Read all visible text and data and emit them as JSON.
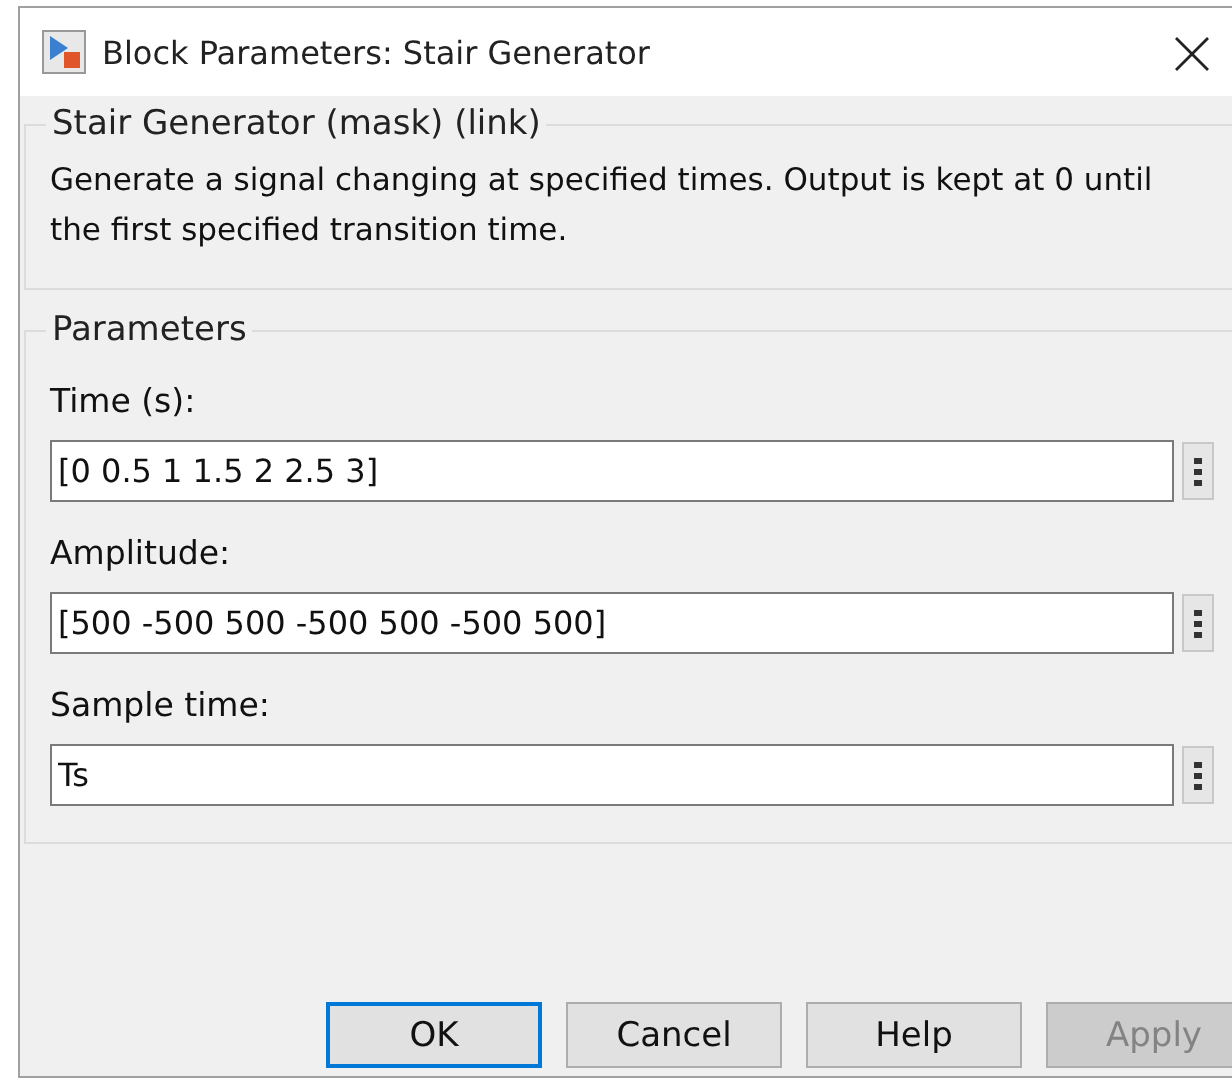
{
  "window": {
    "title": "Block Parameters: Stair Generator"
  },
  "description_group": {
    "title": "Stair Generator (mask) (link)",
    "text": "Generate a signal changing at specified times. Output is kept at 0 until the first specified transition time."
  },
  "parameters_group": {
    "title": "Parameters",
    "fields": [
      {
        "label": "Time (s):",
        "value": "[0 0.5 1 1.5 2 2.5 3]"
      },
      {
        "label": "Amplitude:",
        "value": "[500 -500 500 -500 500 -500 500]"
      },
      {
        "label": "Sample time:",
        "value": "Ts"
      }
    ]
  },
  "buttons": [
    {
      "label": "OK",
      "focused": true,
      "disabled": false
    },
    {
      "label": "Cancel",
      "focused": false,
      "disabled": false
    },
    {
      "label": "Help",
      "focused": false,
      "disabled": false
    },
    {
      "label": "Apply",
      "focused": false,
      "disabled": true
    }
  ]
}
